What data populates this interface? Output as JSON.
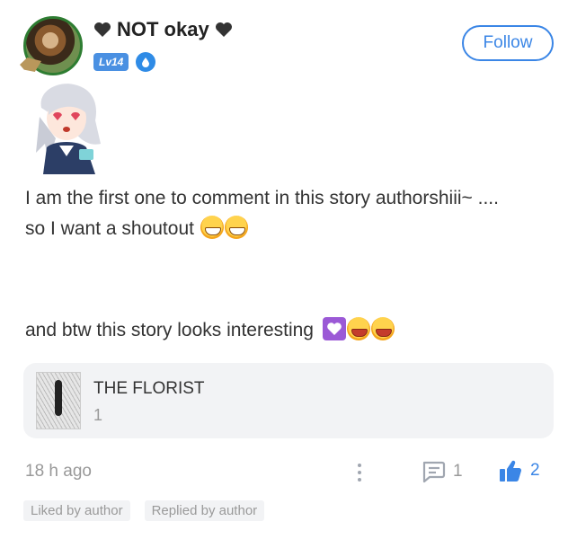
{
  "header": {
    "username": "NOT okay",
    "level_badge": "Lv14",
    "follow_label": "Follow",
    "heart_icon": "black-heart-icon",
    "role_icon": "water-drop-badge-icon"
  },
  "comment": {
    "line1": "I am the first one to comment in this story authorshiii~ ....",
    "line2": "so I want a shoutout",
    "line3": "and btw this story looks interesting"
  },
  "story_card": {
    "title": "THE FLORIST",
    "subtitle": "1"
  },
  "footer": {
    "time": "18 h ago",
    "reply_count": "1",
    "like_count": "2"
  },
  "tags": [
    "Liked by author",
    "Replied by author"
  ],
  "colors": {
    "accent": "#3b86e6",
    "muted": "#999999",
    "card_bg": "#f2f3f5"
  }
}
